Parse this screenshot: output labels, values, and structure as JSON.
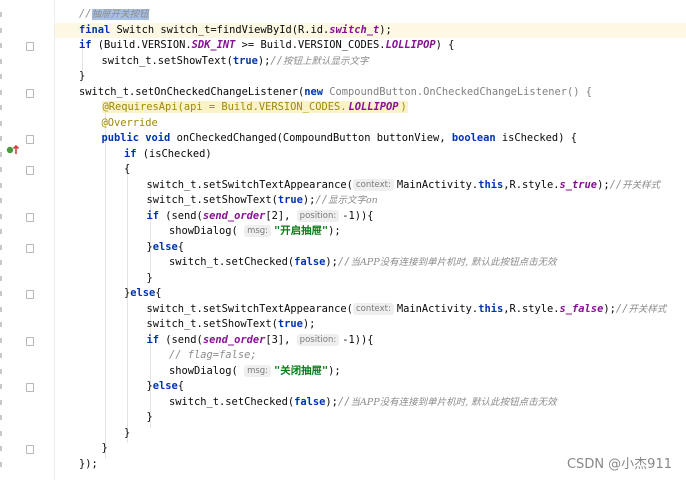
{
  "editor": {
    "lines": [
      {
        "indent": 0,
        "parts": [
          [
            "cmt2",
            "//"
          ],
          [
            "cmt sel",
            "抽屉开关按钮"
          ]
        ]
      },
      {
        "indent": 0,
        "hl": true,
        "parts": [
          [
            "kw",
            "final "
          ],
          [
            "",
            "Switch switch_t=findViewById(R.id."
          ],
          [
            "fld",
            "switch_t"
          ],
          [
            "",
            ");"
          ]
        ]
      },
      {
        "indent": 0,
        "parts": [
          [
            "kw",
            "if "
          ],
          [
            "",
            "(Build.VERSION."
          ],
          [
            "fld",
            "SDK_INT"
          ],
          [
            "",
            " >= Build.VERSION_CODES."
          ],
          [
            "fld",
            "LOLLIPOP"
          ],
          [
            "",
            ") {"
          ]
        ]
      },
      {
        "indent": 1,
        "parts": [
          [
            "",
            "switch_t.setShowText("
          ],
          [
            "kw",
            "true"
          ],
          [
            "",
            ");"
          ],
          [
            "cmt2",
            "//"
          ],
          [
            "cmt",
            "按钮上默认显示文字"
          ]
        ]
      },
      {
        "indent": 0,
        "parts": [
          [
            "",
            "}"
          ]
        ]
      },
      {
        "indent": 0,
        "parts": [
          [
            "",
            "switch_t.setOnCheckedChangeListener("
          ],
          [
            "kw",
            "new "
          ],
          [
            "grey",
            "CompoundButton.OnCheckedChangeListener() {"
          ]
        ]
      },
      {
        "indent": 1,
        "parts": [
          [
            "ann ann-bg",
            "@RequiresApi(api = Build.VERSION_CODES."
          ],
          [
            "fld ann-bg",
            "LOLLIPOP"
          ],
          [
            "ann ann-bg",
            ")"
          ]
        ]
      },
      {
        "indent": 1,
        "parts": [
          [
            "ann",
            "@Override"
          ]
        ]
      },
      {
        "indent": 1,
        "parts": [
          [
            "kw",
            "public void "
          ],
          [
            "",
            "onCheckedChanged(CompoundButton buttonView, "
          ],
          [
            "kw",
            "boolean "
          ],
          [
            "",
            "isChecked) {"
          ]
        ]
      },
      {
        "indent": 2,
        "parts": [
          [
            "kw",
            "if "
          ],
          [
            "",
            "(isChecked)"
          ]
        ]
      },
      {
        "indent": 2,
        "parts": [
          [
            "",
            "{"
          ]
        ]
      },
      {
        "indent": 3,
        "parts": [
          [
            "",
            "switch_t.setSwitchTextAppearance("
          ],
          [
            "hint",
            "context:"
          ],
          [
            "",
            "MainActivity."
          ],
          [
            "kw",
            "this"
          ],
          [
            "",
            ",R.style."
          ],
          [
            "fld",
            "s_true"
          ],
          [
            "",
            ");"
          ],
          [
            "cmt2",
            "//"
          ],
          [
            "cmt",
            "开关样式"
          ]
        ]
      },
      {
        "indent": 3,
        "parts": [
          [
            "",
            "switch_t.setShowText("
          ],
          [
            "kw",
            "true"
          ],
          [
            "",
            ");"
          ],
          [
            "cmt2",
            "//"
          ],
          [
            "cmt",
            "显示文字on"
          ]
        ]
      },
      {
        "indent": 3,
        "parts": [
          [
            "kw",
            "if "
          ],
          [
            "",
            "(send("
          ],
          [
            "fld",
            "send_order"
          ],
          [
            "",
            "[2], "
          ],
          [
            "hint",
            "position:"
          ],
          [
            "",
            "-1)){"
          ]
        ]
      },
      {
        "indent": 4,
        "parts": [
          [
            "",
            "showDialog( "
          ],
          [
            "hint",
            "msg:"
          ],
          [
            "str",
            "\"开启抽屉\""
          ],
          [
            "",
            ");"
          ]
        ]
      },
      {
        "indent": 3,
        "parts": [
          [
            "",
            "}"
          ],
          [
            "kw",
            "else"
          ],
          [
            "",
            "{"
          ]
        ]
      },
      {
        "indent": 4,
        "parts": [
          [
            "",
            "switch_t.setChecked("
          ],
          [
            "kw",
            "false"
          ],
          [
            "",
            ");"
          ],
          [
            "cmt2",
            "//"
          ],
          [
            "cmt",
            "当APP没有连接到单片机时, 默认此按钮点击无效"
          ]
        ]
      },
      {
        "indent": 3,
        "parts": [
          [
            "",
            "}"
          ]
        ]
      },
      {
        "indent": 2,
        "parts": [
          [
            "",
            "}"
          ],
          [
            "kw",
            "else"
          ],
          [
            "",
            "{"
          ]
        ]
      },
      {
        "indent": 3,
        "parts": [
          [
            "",
            "switch_t.setSwitchTextAppearance("
          ],
          [
            "hint",
            "context:"
          ],
          [
            "",
            "MainActivity."
          ],
          [
            "kw",
            "this"
          ],
          [
            "",
            ",R.style."
          ],
          [
            "fld",
            "s_false"
          ],
          [
            "",
            ");"
          ],
          [
            "cmt2",
            "//"
          ],
          [
            "cmt",
            "开关样式"
          ]
        ]
      },
      {
        "indent": 3,
        "parts": [
          [
            "",
            "switch_t.setShowText("
          ],
          [
            "kw",
            "true"
          ],
          [
            "",
            ");"
          ]
        ]
      },
      {
        "indent": 3,
        "parts": [
          [
            "kw",
            "if "
          ],
          [
            "",
            "(send("
          ],
          [
            "fld",
            "send_order"
          ],
          [
            "",
            "[3], "
          ],
          [
            "hint",
            "position:"
          ],
          [
            "",
            "-1)){"
          ]
        ]
      },
      {
        "indent": 4,
        "parts": [
          [
            "cmt2",
            "// flag=false;"
          ]
        ]
      },
      {
        "indent": 4,
        "parts": [
          [
            "",
            "showDialog( "
          ],
          [
            "hint",
            "msg:"
          ],
          [
            "str",
            "\"关闭抽屉\""
          ],
          [
            "",
            ");"
          ]
        ]
      },
      {
        "indent": 3,
        "parts": [
          [
            "",
            "}"
          ],
          [
            "kw",
            "else"
          ],
          [
            "",
            "{"
          ]
        ]
      },
      {
        "indent": 4,
        "parts": [
          [
            "",
            "switch_t.setChecked("
          ],
          [
            "kw",
            "false"
          ],
          [
            "",
            ");"
          ],
          [
            "cmt2",
            "//"
          ],
          [
            "cmt",
            "当APP没有连接到单片机时, 默认此按钮点击无效"
          ]
        ]
      },
      {
        "indent": 3,
        "parts": [
          [
            "",
            "}"
          ]
        ]
      },
      {
        "indent": 2,
        "parts": [
          [
            "",
            "}"
          ]
        ]
      },
      {
        "indent": 1,
        "parts": [
          [
            "",
            "}"
          ]
        ]
      },
      {
        "indent": 0,
        "parts": [
          [
            "",
            "});"
          ]
        ]
      }
    ]
  },
  "watermark": "CSDN @小杰911"
}
